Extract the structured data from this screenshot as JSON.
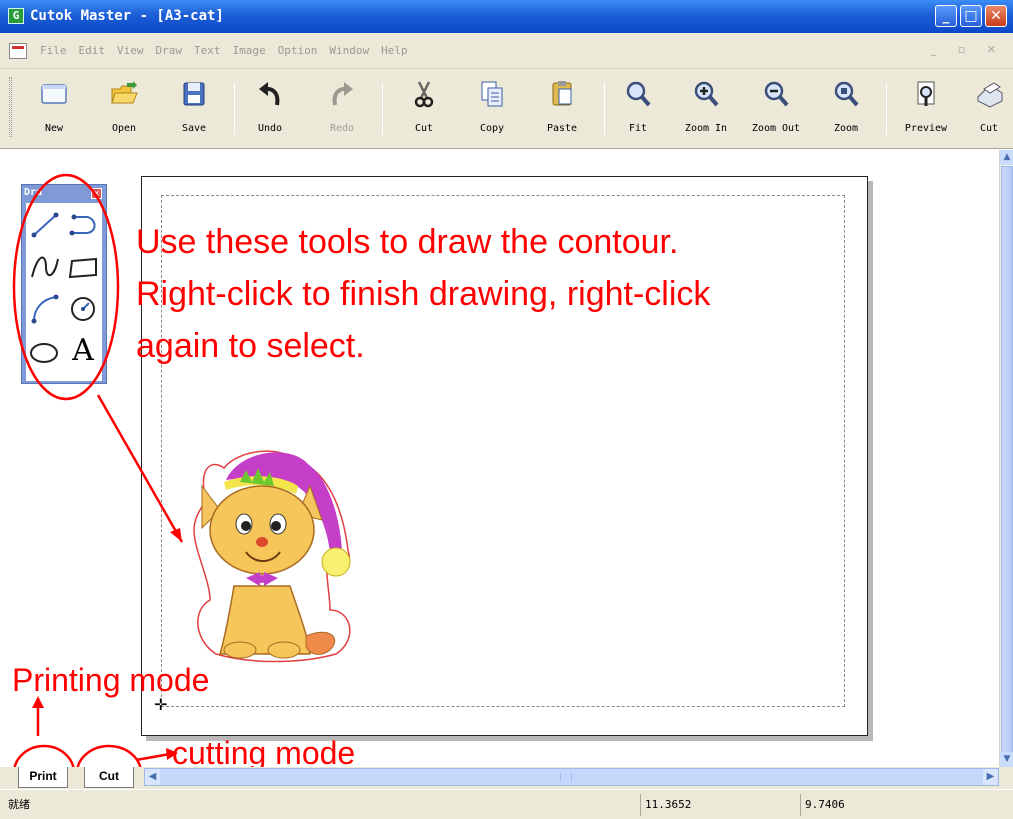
{
  "window": {
    "title": "Cutok Master - [A3-cat]",
    "app_icon": "app-logo-icon",
    "controls": [
      "minimize-icon",
      "maximize-icon",
      "close-icon"
    ]
  },
  "menu": {
    "items": [
      "File",
      "Edit",
      "View",
      "Draw",
      "Text",
      "Image",
      "Option",
      "Window",
      "Help"
    ]
  },
  "toolbar": {
    "buttons": [
      {
        "label": "New",
        "icon": "new-document-icon",
        "enabled": true
      },
      {
        "label": "Open",
        "icon": "open-folder-icon",
        "enabled": true
      },
      {
        "label": "Save",
        "icon": "save-floppy-icon",
        "enabled": true
      },
      {
        "label": "Undo",
        "icon": "undo-arrow-icon",
        "enabled": true
      },
      {
        "label": "Redo",
        "icon": "redo-arrow-icon",
        "enabled": false
      },
      {
        "label": "Cut",
        "icon": "scissors-icon",
        "enabled": true
      },
      {
        "label": "Copy",
        "icon": "copy-icon",
        "enabled": true
      },
      {
        "label": "Paste",
        "icon": "paste-clipboard-icon",
        "enabled": true
      },
      {
        "label": "Fit",
        "icon": "zoom-fit-icon",
        "enabled": true
      },
      {
        "label": "Zoom In",
        "icon": "zoom-in-icon",
        "enabled": true
      },
      {
        "label": "Zoom Out",
        "icon": "zoom-out-icon",
        "enabled": true
      },
      {
        "label": "Zoom",
        "icon": "zoom-icon",
        "enabled": true
      },
      {
        "label": "Preview",
        "icon": "preview-icon",
        "enabled": true
      },
      {
        "label": "Cut",
        "icon": "plotter-cut-icon",
        "enabled": true
      }
    ]
  },
  "palette": {
    "title": "Dra",
    "tools": [
      "line-tool-icon",
      "bezier-tool-icon",
      "curve-tool-icon",
      "rectangle-tool-icon",
      "arc-tool-icon",
      "circle-tool-icon",
      "ellipse-tool-icon",
      "text-tool-icon"
    ],
    "text_tool_glyph": "A"
  },
  "annotations": {
    "main_line1": "Use these tools to draw the contour.",
    "main_line2": "Right-click to finish drawing, right-click",
    "main_line3": "again to select.",
    "printing": "Printing mode",
    "cutting": "cutting mode"
  },
  "tabs": [
    "Print",
    "Cut"
  ],
  "status": {
    "state": "就绪",
    "x": "11.3652",
    "y": "9.7406"
  },
  "colors": {
    "annotation": "#ff0000",
    "titlebar": "#0a48c8",
    "chrome": "#ece9d8"
  }
}
